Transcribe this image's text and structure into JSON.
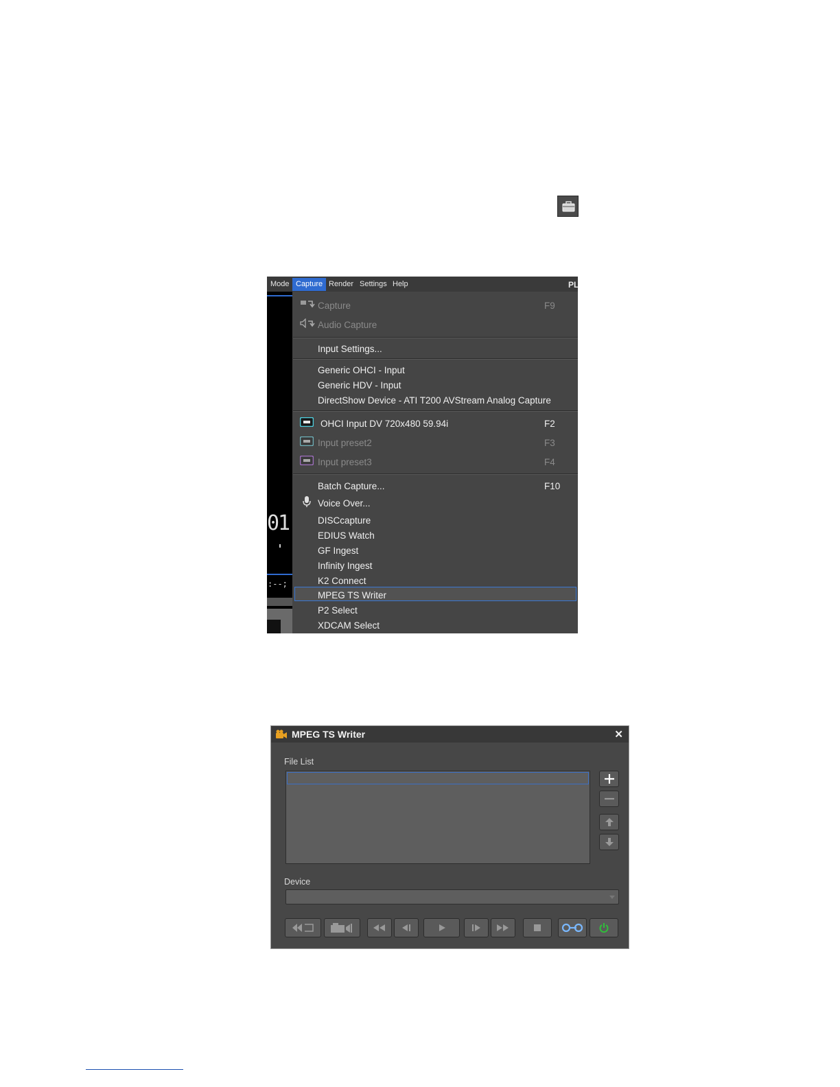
{
  "menubar": {
    "items": [
      "Mode",
      "Capture",
      "Render",
      "Settings",
      "Help"
    ],
    "active": "Capture",
    "right_fragment": "PL"
  },
  "preview": {
    "timecode_fragment": "01",
    "timecode_display": ":--;"
  },
  "capture_menu": {
    "capture": {
      "label": "Capture",
      "shortcut": "F9"
    },
    "audio_capture": {
      "label": "Audio Capture"
    },
    "input_settings": {
      "label": "Input Settings..."
    },
    "generic_ohci": {
      "label": "Generic OHCI - Input"
    },
    "generic_hdv": {
      "label": "Generic HDV - Input"
    },
    "directshow": {
      "label": "DirectShow Device - ATI T200 AVStream Analog Capture"
    },
    "ohci_preset": {
      "label": "OHCI Input  DV 720x480 59.94i",
      "shortcut": "F2"
    },
    "input_preset2": {
      "label": "Input preset2",
      "shortcut": "F3"
    },
    "input_preset3": {
      "label": "Input preset3",
      "shortcut": "F4"
    },
    "batch_capture": {
      "label": "Batch Capture...",
      "shortcut": "F10"
    },
    "voice_over": {
      "label": "Voice Over..."
    },
    "disccapture": {
      "label": "DISCcapture"
    },
    "edius_watch": {
      "label": "EDIUS Watch"
    },
    "gf_ingest": {
      "label": "GF Ingest"
    },
    "infinity_ingest": {
      "label": "Infinity Ingest"
    },
    "k2_connect": {
      "label": "K2 Connect"
    },
    "mpeg_ts_writer": {
      "label": "MPEG TS Writer"
    },
    "p2_select": {
      "label": "P2 Select"
    },
    "xdcam_select": {
      "label": "XDCAM Select"
    }
  },
  "dialog": {
    "title": "MPEG TS Writer",
    "close": "✕",
    "file_list_label": "File List",
    "device_label": "Device",
    "device_value": ""
  },
  "colors": {
    "menu_bg": "#454545",
    "highlight_border": "#3a78d4",
    "active_menu": "#2f6bd0",
    "power_green": "#2fbf3a"
  }
}
